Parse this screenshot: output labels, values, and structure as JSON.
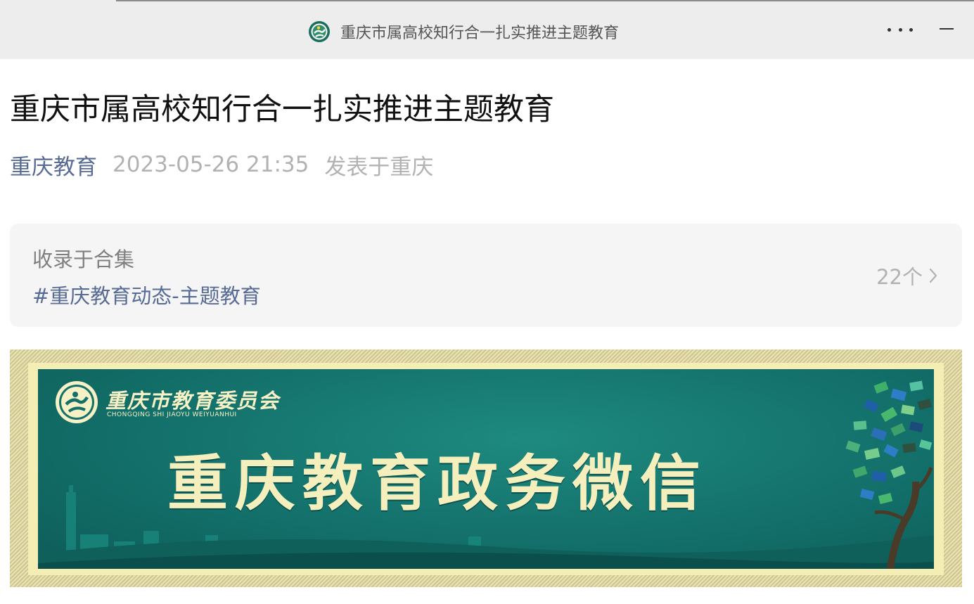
{
  "window": {
    "title": "重庆市属高校知行合一扎实推进主题教育",
    "icons": [
      "education-logo-icon",
      "more-icon",
      "minimize-icon"
    ]
  },
  "article": {
    "title": "重庆市属高校知行合一扎实推进主题教育",
    "author": "重庆教育",
    "date": "2023-05-26 21:35",
    "location": "发表于重庆"
  },
  "collection": {
    "label": "收录于合集",
    "tag": "#重庆教育动态-主题教育",
    "count": "22个"
  },
  "banner": {
    "department": "重庆市教育委员会",
    "department_pinyin": "CHONGQING SHI JIAOYU WEIYUANHUI",
    "title": "重庆教育政务微信"
  },
  "colors": {
    "link": "#576b95",
    "meta_gray": "#b2b2b2",
    "banner_teal": "#13706a",
    "banner_text": "#f5efbd"
  }
}
